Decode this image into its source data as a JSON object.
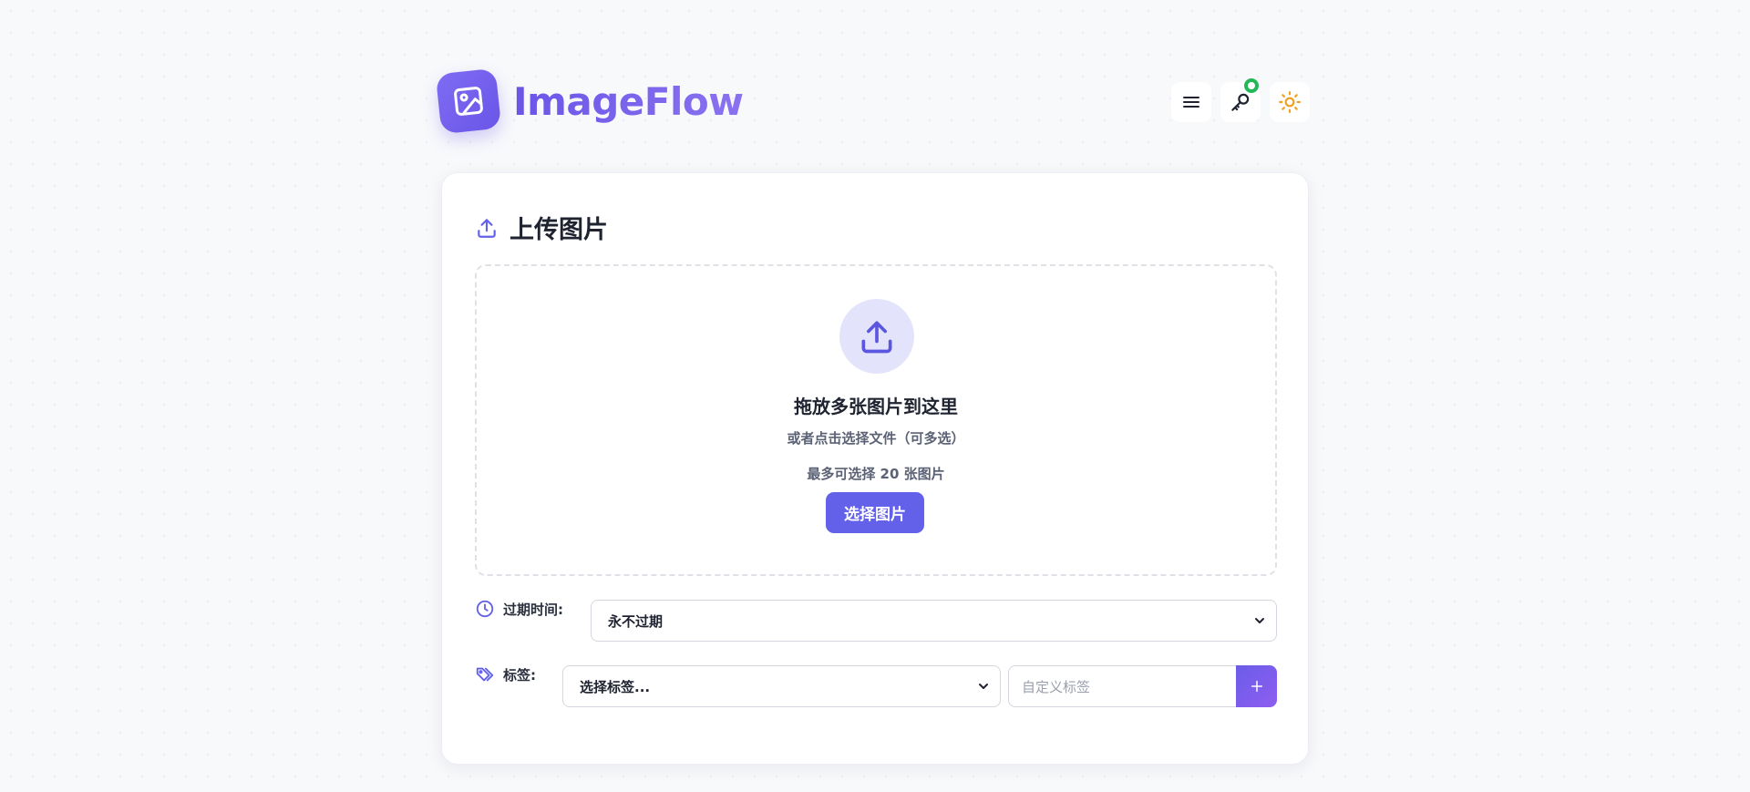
{
  "header": {
    "brand_name": "ImageFlow",
    "logo_icon": "image-icon",
    "actions": [
      {
        "name": "menu-icon"
      },
      {
        "name": "key-icon",
        "status_color": "#22b857"
      },
      {
        "name": "sun-icon",
        "color": "#f0a020"
      }
    ]
  },
  "upload": {
    "title": "上传图片",
    "title_icon": "upload-icon",
    "dropzone": {
      "title": "拖放多张图片到这里",
      "subtitle": "或者点击选择文件（可多选）",
      "limit": "最多可选择 20 张图片",
      "button_label": "选择图片"
    },
    "expiry": {
      "label": "过期时间:",
      "selected": "永不过期"
    },
    "tags": {
      "label": "标签:",
      "select_placeholder": "选择标签...",
      "custom_placeholder": "自定义标签",
      "add_button_label": "+"
    }
  },
  "colors": {
    "accent": "#6360ea",
    "brand": "#6e5ce8",
    "status_online": "#22b857",
    "sun": "#f0a020"
  }
}
